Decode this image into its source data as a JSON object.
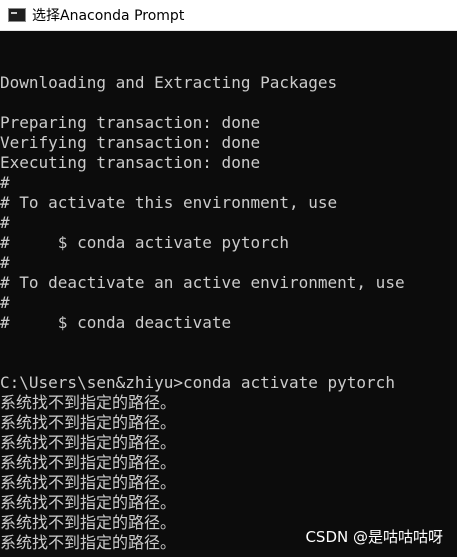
{
  "window": {
    "title": "选择Anaconda Prompt",
    "icon": "console-window-icon"
  },
  "console": {
    "lines": [
      "Downloading and Extracting Packages",
      "",
      "Preparing transaction: done",
      "Verifying transaction: done",
      "Executing transaction: done",
      "#",
      "# To activate this environment, use",
      "#",
      "#     $ conda activate pytorch",
      "#",
      "# To deactivate an active environment, use",
      "#",
      "#     $ conda deactivate",
      "",
      "",
      "C:\\Users\\sen&zhiyu>conda activate pytorch",
      "系统找不到指定的路径。",
      "系统找不到指定的路径。",
      "系统找不到指定的路径。",
      "系统找不到指定的路径。",
      "系统找不到指定的路径。",
      "系统找不到指定的路径。",
      "系统找不到指定的路径。",
      "系统找不到指定的路径。"
    ]
  },
  "watermark": {
    "text": "CSDN @是咕咕咕呀"
  },
  "colors": {
    "console_background": "#0c0c0c",
    "console_text": "#cccccc",
    "titlebar_background": "#ffffff"
  }
}
